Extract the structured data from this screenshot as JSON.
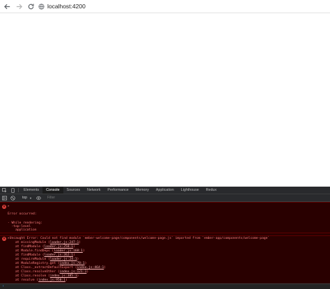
{
  "browser": {
    "url": "localhost:4200"
  },
  "devtools": {
    "tabs": [
      {
        "label": "Elements"
      },
      {
        "label": "Console"
      },
      {
        "label": "Sources"
      },
      {
        "label": "Network"
      },
      {
        "label": "Performance"
      },
      {
        "label": "Memory"
      },
      {
        "label": "Application"
      },
      {
        "label": "Lighthouse"
      },
      {
        "label": "Redux"
      }
    ],
    "active_tab": "Console",
    "toolbar": {
      "context": "top",
      "filter_placeholder": "Filter"
    }
  },
  "console": {
    "message1": {
      "lines": [
        "▸",
        "Error occurred:",
        "",
        "- While rendering:",
        "  -top-level",
        "    application"
      ]
    },
    "message2": {
      "header": "▸Uncaught Error: Could not find module `ember-welcome-page/components/welcome-page.js` imported from `ember-app/components/welcome-page`",
      "stack": [
        {
          "prefix": "at missingModule (",
          "link": "loader.js:247:1",
          "suffix": ")"
        },
        {
          "prefix": "at findModule (",
          "link": "loader.js:258:1",
          "suffix": ")"
        },
        {
          "prefix": "at Module.findDeps (",
          "link": "loader.js:168:1",
          "suffix": ")"
        },
        {
          "prefix": "at findModule (",
          "link": "loader.js:262:1",
          "suffix": ")"
        },
        {
          "prefix": "at requireModule (",
          "link": "loader.js:24:1",
          "suffix": ")"
        },
        {
          "prefix": "at ModuleRegistry.get (",
          "link": "index.js:78:1",
          "suffix": ")"
        },
        {
          "prefix": "at Class._extractDefaultExport (",
          "link": "index.js:464:1",
          "suffix": ")"
        },
        {
          "prefix": "at Class.resolveOther (",
          "link": "index.js:121:1",
          "suffix": ")"
        },
        {
          "prefix": "at Class.resolve (",
          "link": "index.js:385:1",
          "suffix": ")"
        },
        {
          "prefix": "at resolve (",
          "link": "index.js:950:1",
          "suffix": ")"
        }
      ]
    },
    "prompt": "›"
  },
  "colors": {
    "console_bg": "#290000",
    "error_text": "#ff8080",
    "error_icon": "#e0413b"
  }
}
